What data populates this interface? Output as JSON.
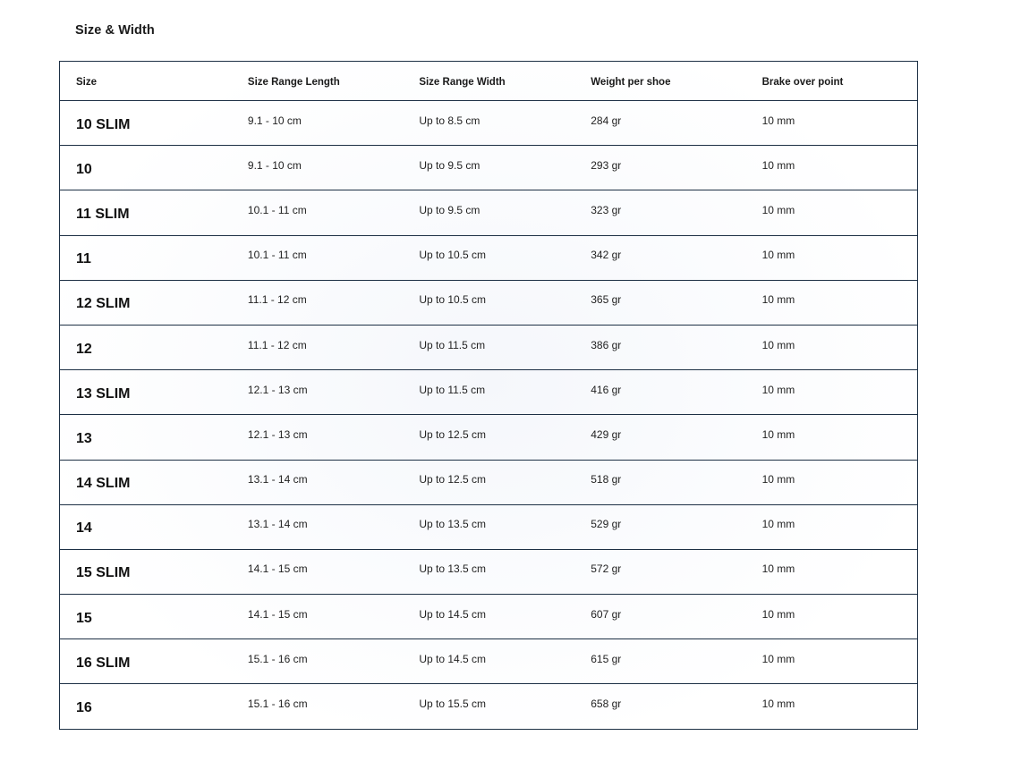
{
  "page": {
    "title": "Size & Width"
  },
  "table": {
    "headers": [
      "Size",
      "Size Range Length",
      "Size Range Width",
      "Weight per shoe",
      "Brake over point"
    ],
    "rows": [
      [
        "10 SLIM",
        "9.1 - 10 cm",
        "Up to 8.5 cm",
        "284 gr",
        "10 mm"
      ],
      [
        "10",
        "9.1 - 10 cm",
        "Up to 9.5 cm",
        "293 gr",
        "10 mm"
      ],
      [
        "11 SLIM",
        "10.1 - 11 cm",
        "Up to 9.5 cm",
        "323 gr",
        "10 mm"
      ],
      [
        "11",
        "10.1 - 11 cm",
        "Up to 10.5 cm",
        "342 gr",
        "10 mm"
      ],
      [
        "12 SLIM",
        "11.1 - 12 cm",
        "Up to 10.5 cm",
        "365 gr",
        "10 mm"
      ],
      [
        "12",
        "11.1 - 12 cm",
        "Up to 11.5 cm",
        "386 gr",
        "10 mm"
      ],
      [
        "13 SLIM",
        "12.1 - 13 cm",
        "Up to 11.5 cm",
        "416 gr",
        "10 mm"
      ],
      [
        "13",
        "12.1 - 13 cm",
        "Up to 12.5 cm",
        "429 gr",
        "10 mm"
      ],
      [
        "14 SLIM",
        "13.1 - 14 cm",
        "Up to 12.5 cm",
        "518 gr",
        "10 mm"
      ],
      [
        "14",
        "13.1 - 14 cm",
        "Up to 13.5 cm",
        "529 gr",
        "10 mm"
      ],
      [
        "15 SLIM",
        "14.1 - 15 cm",
        "Up to 13.5 cm",
        "572 gr",
        "10 mm"
      ],
      [
        "15",
        "14.1 - 15 cm",
        "Up to 14.5 cm",
        "607 gr",
        "10 mm"
      ],
      [
        "16 SLIM",
        "15.1 - 16 cm",
        "Up to 14.5 cm",
        "615 gr",
        "10 mm"
      ],
      [
        "16",
        "15.1 - 16 cm",
        "Up to 15.5 cm",
        "658 gr",
        "10 mm"
      ]
    ]
  },
  "colors": {
    "border": "#1d3045",
    "text": "#111111"
  }
}
